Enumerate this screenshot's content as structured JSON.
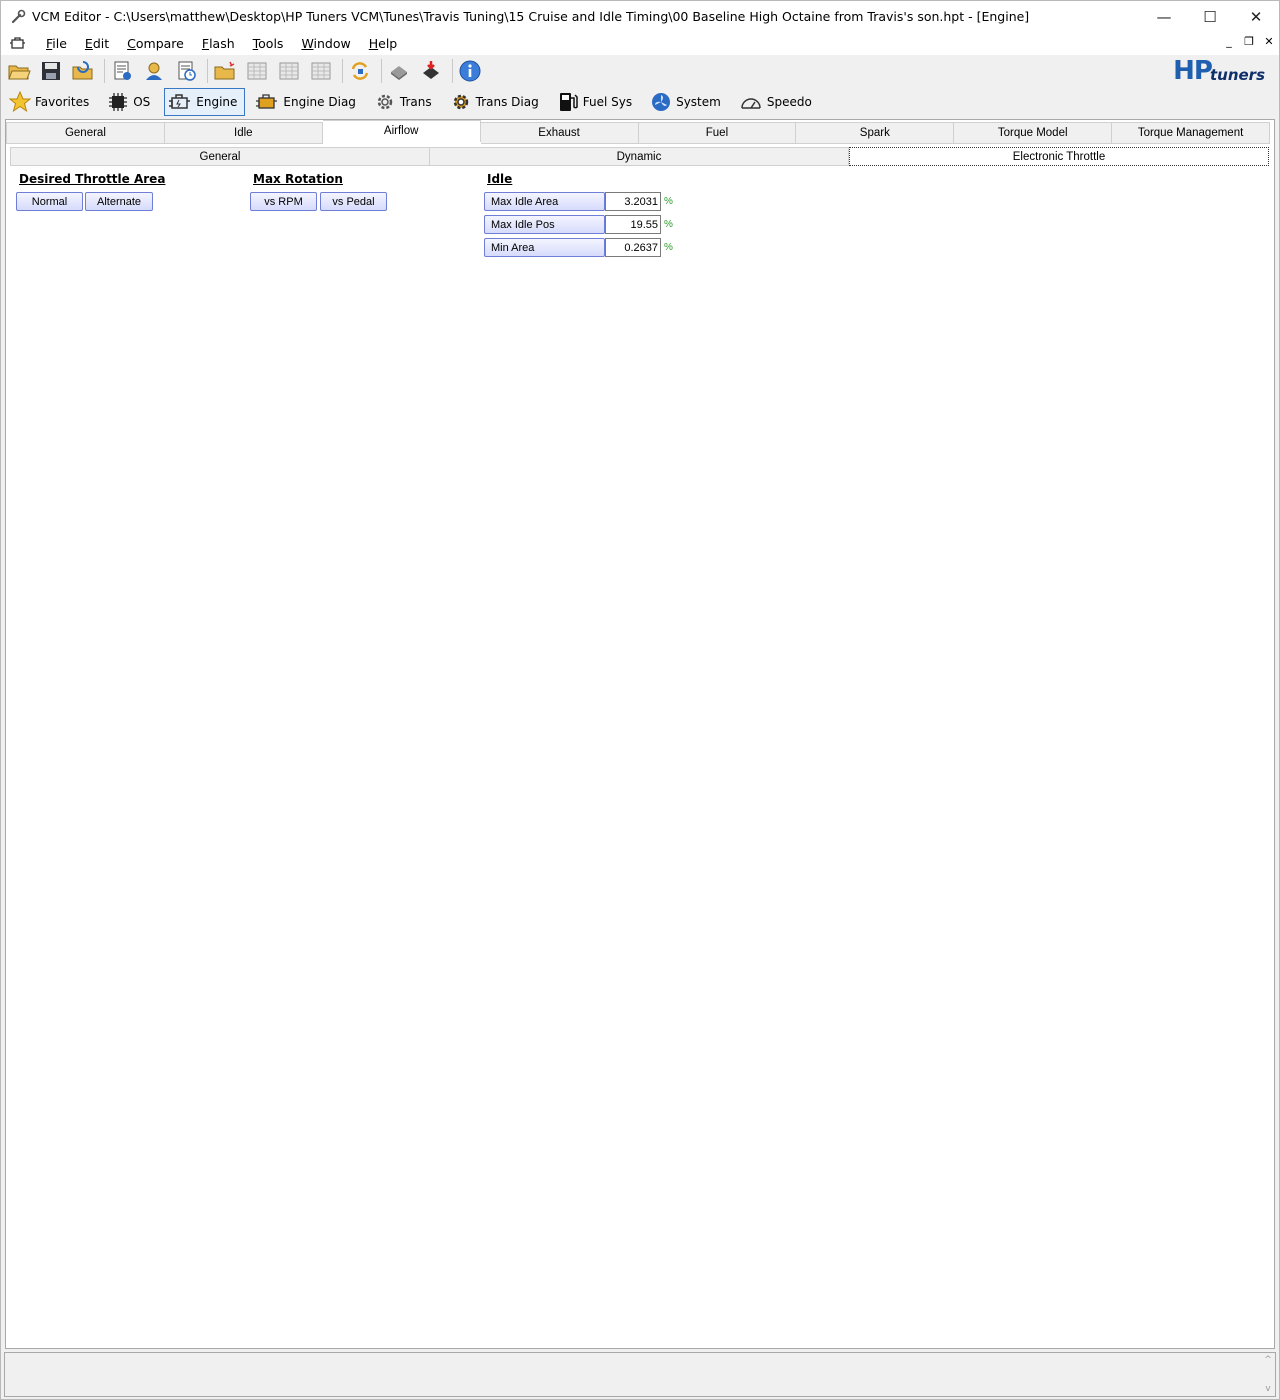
{
  "window": {
    "title": "VCM Editor - C:\\Users\\matthew\\Desktop\\HP Tuners VCM\\Tunes\\Travis Tuning\\15 Cruise and Idle Timing\\00 Baseline High Octaine from Travis's son.hpt - [Engine]",
    "controls": {
      "minimize": "—",
      "maximize": "☐",
      "close": "✕"
    }
  },
  "menu": {
    "items": [
      {
        "accel": "F",
        "rest": "ile"
      },
      {
        "accel": "E",
        "rest": "dit"
      },
      {
        "accel": "C",
        "rest": "ompare"
      },
      {
        "accel": "F",
        "rest": "lash"
      },
      {
        "accel": "T",
        "rest": "ools"
      },
      {
        "accel": "W",
        "rest": "indow"
      },
      {
        "accel": "H",
        "rest": "elp"
      }
    ],
    "mdi": {
      "minimize": "_",
      "restore": "❐",
      "close": "✕"
    }
  },
  "toolbar": {
    "icons": [
      "open-folder-icon",
      "save-icon",
      "open-recent-icon",
      "file-info-icon",
      "vehicle-info-icon",
      "file-history-icon",
      "new-folder-icon",
      "table-icon",
      "table-icon",
      "table-icon",
      "refresh-icon",
      "read-vehicle-icon",
      "write-vehicle-icon",
      "info-icon"
    ],
    "logo_hp": "HP",
    "logo_tuners": "tuners"
  },
  "categories": [
    {
      "label": "Favorites",
      "icon": "star-icon",
      "active": false
    },
    {
      "label": "OS",
      "icon": "chip-icon",
      "active": false
    },
    {
      "label": "Engine",
      "icon": "engine-icon",
      "active": true
    },
    {
      "label": "Engine Diag",
      "icon": "engine-diag-icon",
      "active": false
    },
    {
      "label": "Trans",
      "icon": "gear-icon",
      "active": false
    },
    {
      "label": "Trans Diag",
      "icon": "gear-diag-icon",
      "active": false
    },
    {
      "label": "Fuel Sys",
      "icon": "fuel-pump-icon",
      "active": false
    },
    {
      "label": "System",
      "icon": "fan-icon",
      "active": false
    },
    {
      "label": "Speedo",
      "icon": "speedometer-icon",
      "active": false
    }
  ],
  "tabs": {
    "primary": [
      "General",
      "Idle",
      "Airflow",
      "Exhaust",
      "Fuel",
      "Spark",
      "Torque Model",
      "Torque Management"
    ],
    "primary_active": "Airflow",
    "secondary": [
      "General",
      "Dynamic",
      "Electronic Throttle"
    ],
    "secondary_active": "Electronic Throttle"
  },
  "sections": {
    "desired_throttle_area": {
      "title": "Desired Throttle Area",
      "buttons": [
        "Normal",
        "Alternate"
      ]
    },
    "max_rotation": {
      "title": "Max Rotation",
      "buttons": [
        "vs RPM",
        "vs Pedal"
      ]
    },
    "idle": {
      "title": "Idle",
      "params": [
        {
          "label": "Max Idle Area",
          "value": "3.2031",
          "unit": "%"
        },
        {
          "label": "Max Idle Pos",
          "value": "19.55",
          "unit": "%"
        },
        {
          "label": "Min Area",
          "value": "0.2637",
          "unit": "%"
        }
      ]
    }
  },
  "status": {
    "scroll_up": "^",
    "scroll_down": "v"
  }
}
